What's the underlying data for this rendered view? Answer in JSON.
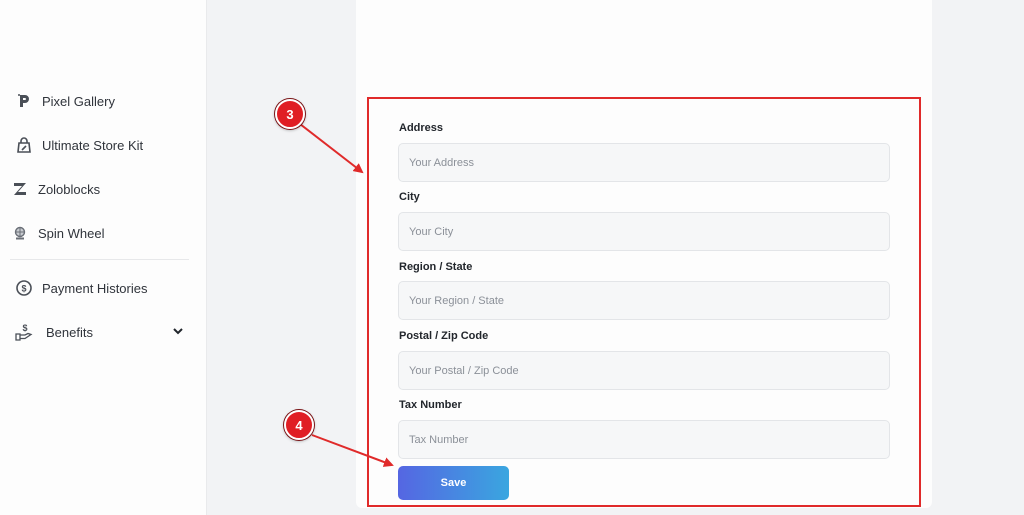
{
  "sidebar": {
    "items": [
      {
        "label": "Pixel Gallery",
        "icon": "pixel-gallery-icon"
      },
      {
        "label": "Ultimate Store Kit",
        "icon": "shopping-bag-icon"
      },
      {
        "label": "Zoloblocks",
        "icon": "zoloblocks-icon"
      },
      {
        "label": "Spin Wheel",
        "icon": "spin-wheel-icon"
      },
      {
        "label": "Payment Histories",
        "icon": "dollar-circle-icon"
      },
      {
        "label": "Benefits",
        "icon": "hand-dollar-icon",
        "expandable": true
      }
    ]
  },
  "form": {
    "fields": [
      {
        "label": "Address",
        "placeholder": "Your Address",
        "value": ""
      },
      {
        "label": "City",
        "placeholder": "Your City",
        "value": ""
      },
      {
        "label": "Region / State",
        "placeholder": "Your Region / State",
        "value": ""
      },
      {
        "label": "Postal / Zip Code",
        "placeholder": "Your Postal / Zip Code",
        "value": ""
      },
      {
        "label": "Tax Number",
        "placeholder": "Tax Number",
        "value": ""
      }
    ],
    "save_label": "Save"
  },
  "annotations": {
    "step_3": "3",
    "step_4": "4",
    "highlight_color": "#e02a2a"
  },
  "colors": {
    "button_gradient_start": "#5566e2",
    "button_gradient_end": "#3aa6e0",
    "badge": "#e01e24"
  }
}
